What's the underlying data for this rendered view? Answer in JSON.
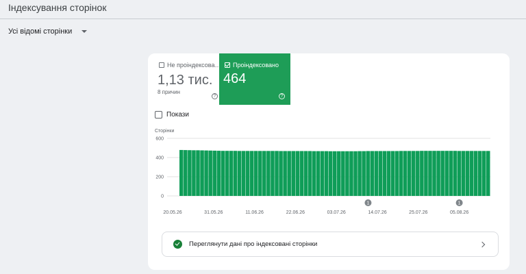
{
  "page": {
    "title": "Індексування сторінок",
    "filter_label": "Усі відомі сторінки"
  },
  "tiles": {
    "not_indexed": {
      "label": "Не проіндексова…",
      "value": "1,13 тис.",
      "sub": "8 причин",
      "help": "?",
      "checked": false
    },
    "indexed": {
      "label": "Проіндексовано",
      "value": "464",
      "help": "?",
      "checked": true
    }
  },
  "impressions": {
    "label": "Покази",
    "checked": false
  },
  "chart_data": {
    "type": "bar",
    "ylabel": "Сторінки",
    "ylim": [
      0,
      600
    ],
    "yticks": [
      "600",
      "400",
      "200",
      "0"
    ],
    "xtick_labels": [
      "20.05.26",
      "31.05.26",
      "11.06.26",
      "22.06.26",
      "03.07.26",
      "14.07.26",
      "25.07.26",
      "05.08.26"
    ],
    "annotation_label": "1",
    "annotation_indices": [
      45,
      67
    ],
    "color": "#0f9d58",
    "values": [
      479,
      478,
      477,
      476,
      476,
      475,
      474,
      473,
      472,
      471,
      470,
      470,
      470,
      470,
      469,
      469,
      469,
      469,
      469,
      469,
      469,
      469,
      469,
      469,
      468,
      468,
      468,
      468,
      468,
      468,
      468,
      468,
      467,
      467,
      467,
      467,
      466,
      466,
      466,
      466,
      466,
      466,
      466,
      467,
      467,
      468,
      468,
      468,
      468,
      468,
      468,
      468,
      468,
      469,
      469,
      469,
      469,
      469,
      470,
      470,
      470,
      470,
      470,
      470,
      470,
      470,
      470,
      469,
      469,
      469,
      469,
      469,
      469,
      469,
      469
    ]
  },
  "cta": {
    "label": "Переглянути дані про індексовані сторінки"
  }
}
